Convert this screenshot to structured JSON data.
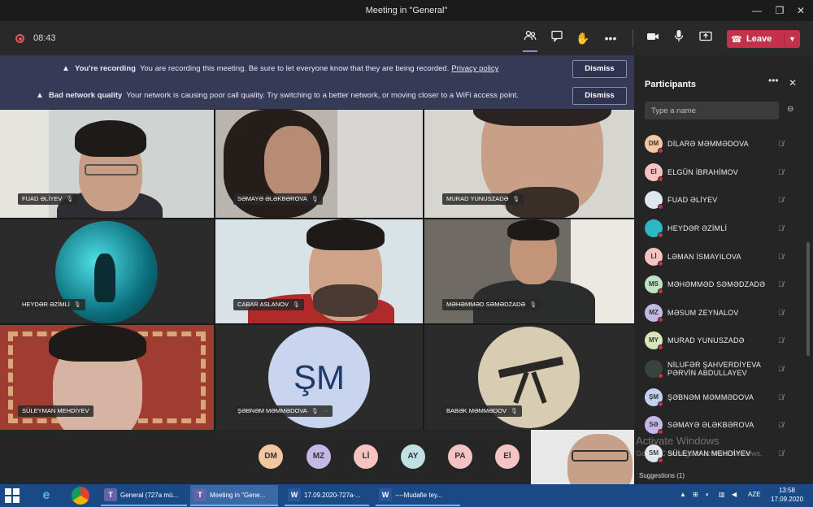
{
  "window": {
    "title": "Meeting in \"General\""
  },
  "toolbar": {
    "timer": "08:43",
    "leave_label": "Leave"
  },
  "banners": {
    "recording": {
      "title": "You're recording",
      "message": "You are recording this meeting. Be sure to let everyone know that they are being recorded.",
      "link": "Privacy policy",
      "dismiss": "Dismiss"
    },
    "network": {
      "title": "Bad network quality",
      "message": "Your network is causing poor call quality. Try switching to a better network, or moving closer to a WiFi access point.",
      "dismiss": "Dismiss"
    }
  },
  "grid": {
    "tiles": [
      {
        "name": "FUAD ƏLİYEV"
      },
      {
        "name": "SƏMAYƏ ƏLƏKBƏROVA"
      },
      {
        "name": "MURAD YUNUSZADƏ"
      },
      {
        "name": "HEYDƏR ƏZİMLİ"
      },
      {
        "name": "CABAR ASLANOV"
      },
      {
        "name": "MƏHƏMMƏD SƏMƏDZADƏ"
      },
      {
        "name": "SÜLEYMAN MEHDİYEV"
      },
      {
        "name": "ŞƏBNƏM MƏMMƏDOVA",
        "initials": "ŞM"
      },
      {
        "name": "BABƏK MƏMMƏDOV"
      }
    ]
  },
  "reaction_chips": [
    {
      "initials": "DM",
      "color": "#f3c8a0"
    },
    {
      "initials": "MZ",
      "color": "#c3b8e6"
    },
    {
      "initials": "Lİ",
      "color": "#f6c3c3"
    },
    {
      "initials": "AY",
      "color": "#bfe0e4"
    },
    {
      "initials": "PA",
      "color": "#f6c3c3"
    },
    {
      "initials": "Eİ",
      "color": "#f6c3c3"
    }
  ],
  "participants": {
    "title": "Participants",
    "search_placeholder": "Type a name",
    "list": [
      {
        "initials": "DM",
        "name": "DİLARƏ MƏMMƏDOVA",
        "color": "#f3c8a0"
      },
      {
        "initials": "Eİ",
        "name": "ELGÜN İBRAHİMOV",
        "color": "#f6c3c3"
      },
      {
        "initials": "",
        "name": "FUAD ƏLİYEV",
        "color": "#dfe7ee"
      },
      {
        "initials": "",
        "name": "HEYDƏR ƏZİMLİ",
        "color": "#2bb8c4"
      },
      {
        "initials": "Lİ",
        "name": "LƏMAN İSMAYILOVA",
        "color": "#f6c3c3"
      },
      {
        "initials": "MS",
        "name": "MƏHƏMMƏD SƏMƏDZADƏ",
        "color": "#bde3c3"
      },
      {
        "initials": "MZ",
        "name": "MƏSUM ZEYNALOV",
        "color": "#c3b8e6"
      },
      {
        "initials": "MY",
        "name": "MURAD YUNUSZADƏ",
        "color": "#d7e7b8"
      },
      {
        "initials": "",
        "name": "NİLUFƏR ŞAHVERDİYEVA",
        "name2": "PƏRVİN ABDULLAYEV",
        "color": "#39443c"
      },
      {
        "initials": "ŞM",
        "name": "ŞƏBNƏM MƏMMƏDOVA",
        "color": "#c3d3ee"
      },
      {
        "initials": "SƏ",
        "name": "SƏMAYƏ ƏLƏKBƏROVA",
        "color": "#c3b8e6"
      },
      {
        "initials": "SM",
        "name": "SÜLEYMAN MEHDİYEV",
        "color": "#dfe7ee"
      }
    ],
    "suggestions": "Suggestions (1)"
  },
  "watermark": {
    "line1": "Activate Windows",
    "line2": "Go to PC settings to activate Windows."
  },
  "taskbar": {
    "apps": [
      {
        "label": "General (727a mü...",
        "icon": "T"
      },
      {
        "label": "Meeting in \"Gene...",
        "icon": "T"
      },
      {
        "label": "17.09.2020-727a-...",
        "icon": "W"
      },
      {
        "label": "----Mudafie tey...",
        "icon": "W"
      }
    ],
    "lang": "AZE",
    "time": "13:58",
    "date": "17.09.2020"
  }
}
